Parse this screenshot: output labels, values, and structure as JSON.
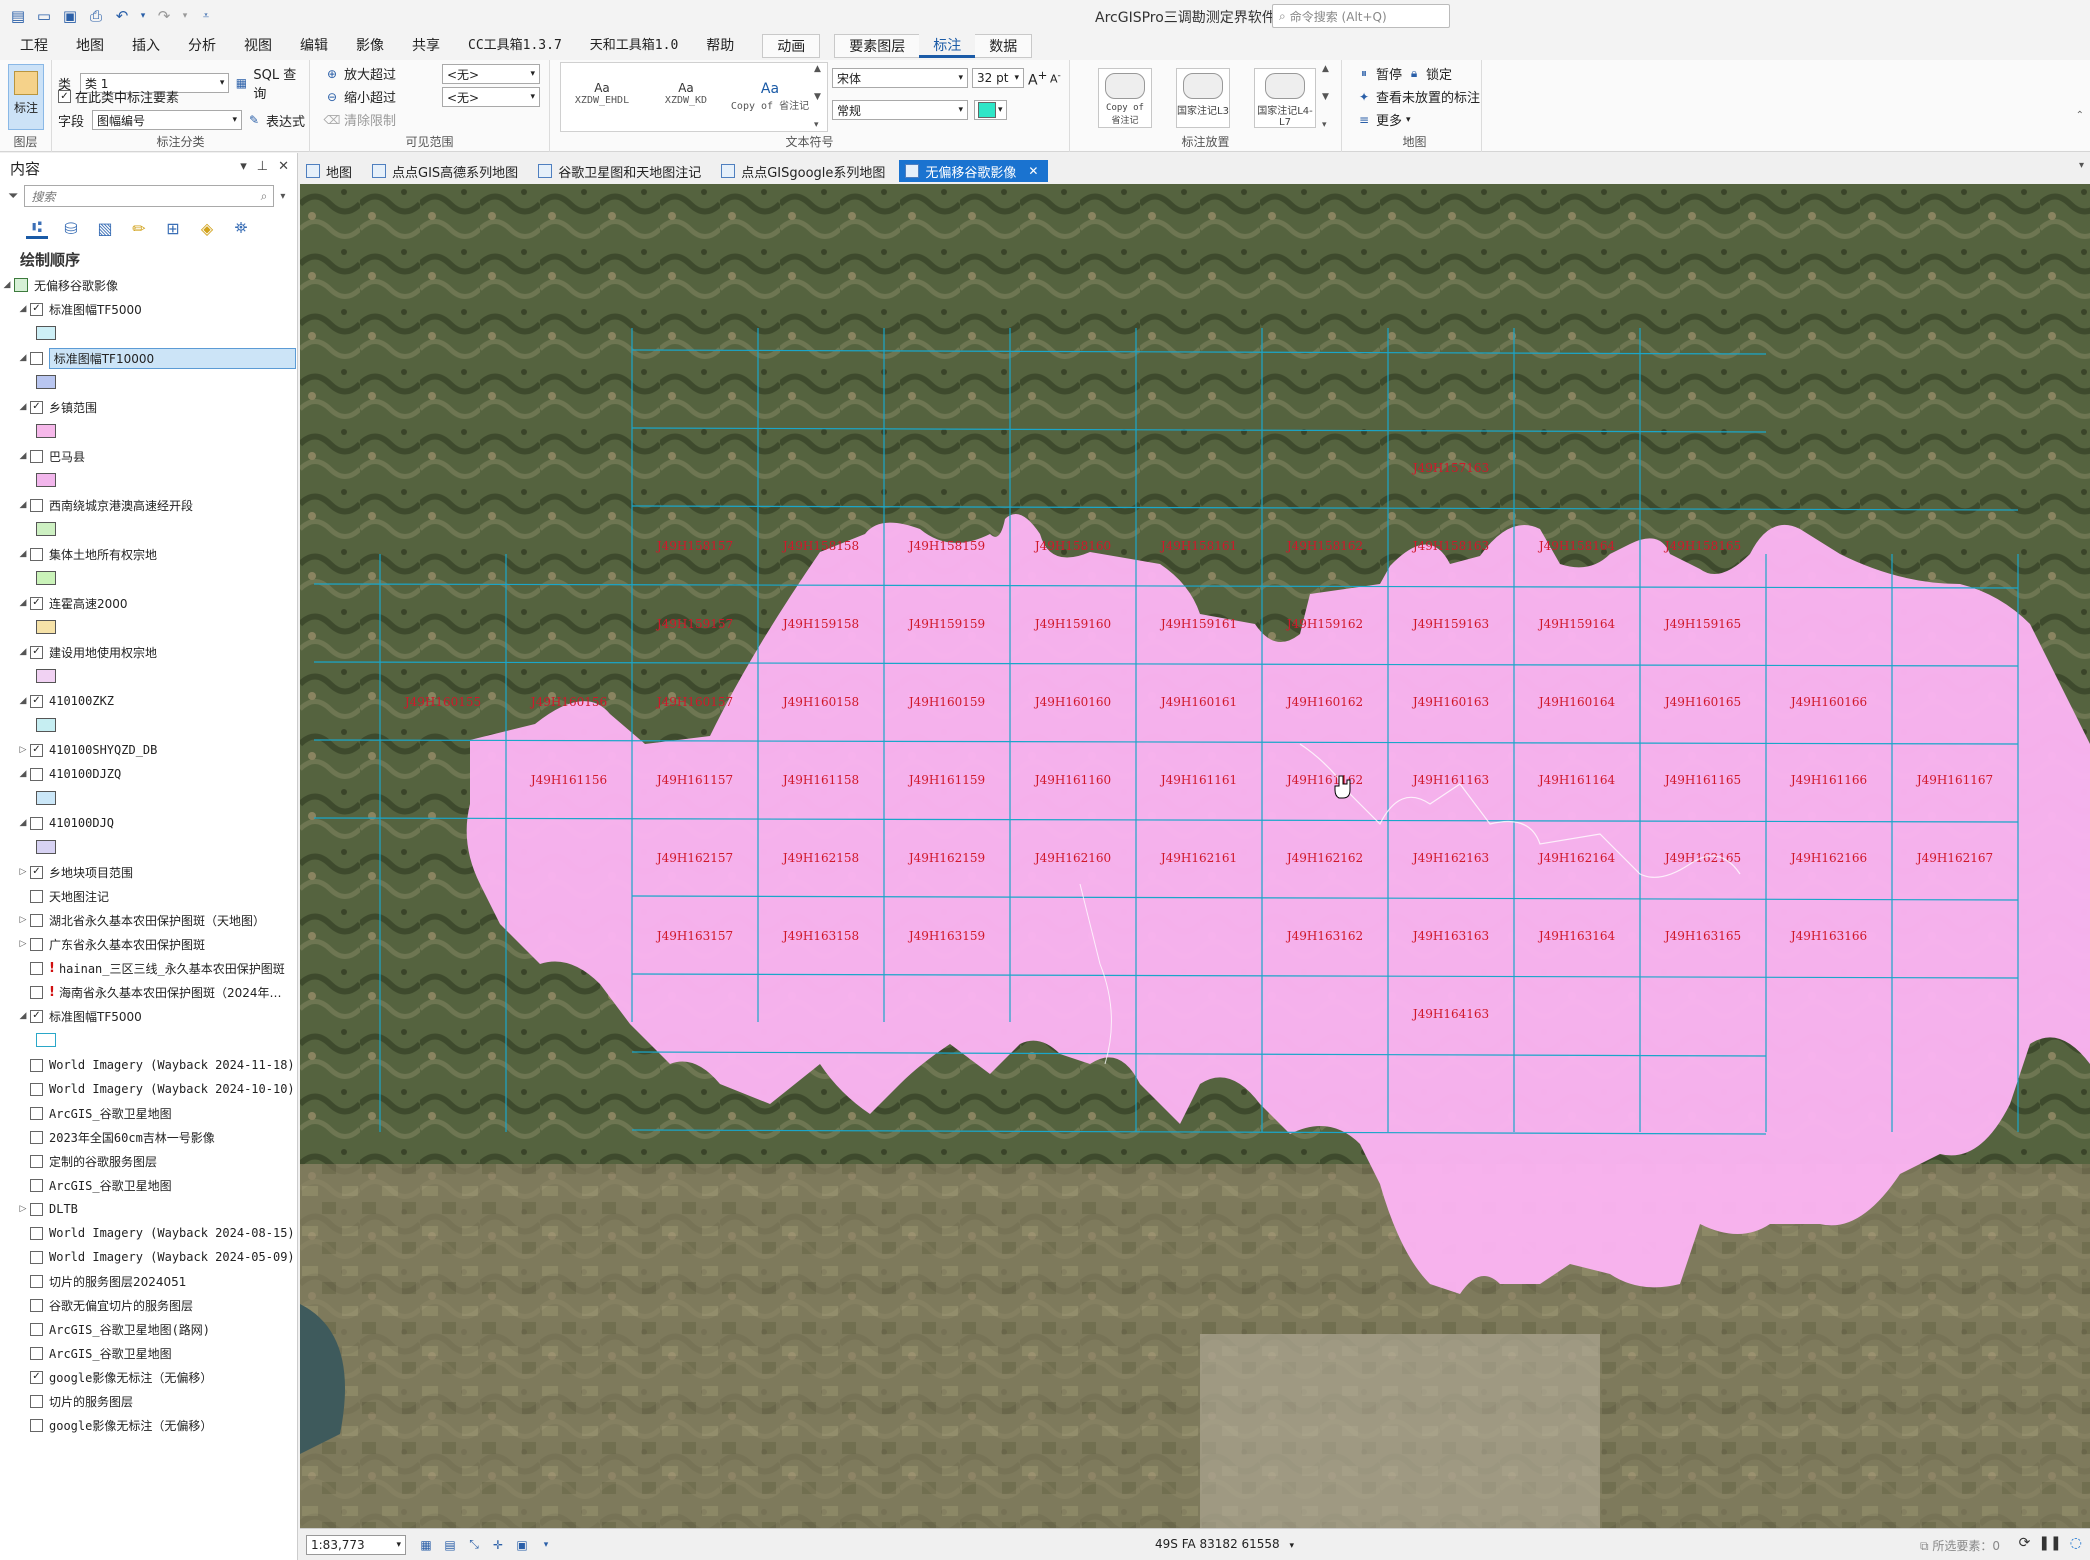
{
  "app": {
    "title": "ArcGISPro三调勘测定界软件",
    "command_search_placeholder": "命令搜索 (Alt+Q)"
  },
  "ribbon_tabs": [
    {
      "label": "工程"
    },
    {
      "label": "地图"
    },
    {
      "label": "插入"
    },
    {
      "label": "分析"
    },
    {
      "label": "视图"
    },
    {
      "label": "编辑"
    },
    {
      "label": "影像"
    },
    {
      "label": "共享"
    },
    {
      "label": "CC工具箱1.3.7"
    },
    {
      "label": "天和工具箱1.0"
    },
    {
      "label": "帮助"
    },
    {
      "label": "动画"
    },
    {
      "label": "要素图层"
    },
    {
      "label": "标注"
    },
    {
      "label": "数据"
    }
  ],
  "ribbon": {
    "layer_group": {
      "button": "标注",
      "title": "图层"
    },
    "class_group": {
      "class_label": "类",
      "class_value": "类 1",
      "sql_button": "SQL 查询",
      "label_in_class": "在此类中标注要素",
      "field_label": "字段",
      "field_value": "图幅编号",
      "expression_button": "表达式",
      "title": "标注分类"
    },
    "visibility_group": {
      "zoom_in_beyond": "放大超过",
      "zoom_out_beyond": "缩小超过",
      "clear_limits": "清除限制",
      "in_value": "<无>",
      "out_value": "<无>",
      "title": "可见范围"
    },
    "text_symbol_group": {
      "styles": [
        "XZDW_EHDL",
        "XZDW_KD",
        "Copy of 省注记"
      ],
      "style_glyph": "Aa",
      "font": "宋体",
      "font_size": "32 pt",
      "font_style": "常规",
      "color": "#2ee6c7",
      "title": "文本符号"
    },
    "placement_group": {
      "items": [
        "Copy of 省注记",
        "国家注记L3",
        "国家注记L4-L7"
      ],
      "title": "标注放置"
    },
    "map_group": {
      "pause": "暂停",
      "lock": "锁定",
      "view_unplaced": "查看未放置的标注",
      "more": "更多",
      "title": "地图"
    }
  },
  "contents": {
    "title": "内容",
    "search_placeholder": "搜索",
    "draw_order": "绘制顺序",
    "map_name": "无偏移谷歌影像",
    "layers": [
      {
        "label": "标准图幅TF5000",
        "checked": true,
        "expand": "▲",
        "symbol": "#cdeff6"
      },
      {
        "label": "标准图幅TF10000",
        "checked": false,
        "expand": "▲",
        "symbol": "#b9c6f0",
        "selected": true
      },
      {
        "label": "乡镇范围",
        "checked": true,
        "expand": "▲",
        "symbol": "#f6b8ea"
      },
      {
        "label": "巴马县",
        "checked": false,
        "expand": "▲",
        "symbol": "#f2b6ec"
      },
      {
        "label": "西南绕城京港澳高速经开段",
        "checked": false,
        "expand": "▲",
        "symbol": "#cdf0c2"
      },
      {
        "label": "集体土地所有权宗地",
        "checked": false,
        "expand": "▲",
        "symbol": "#caf3b9"
      },
      {
        "label": "连霍高速2000",
        "checked": true,
        "expand": "▲",
        "symbol": "#f6e2a8"
      },
      {
        "label": "建设用地使用权宗地",
        "checked": true,
        "expand": "▲",
        "symbol": "#f1d2f3"
      },
      {
        "label": "410100ZKZ",
        "checked": true,
        "expand": "▲",
        "symbol": "#c6eef2"
      },
      {
        "label": "410100SHYQZD_DB",
        "checked": true,
        "expand": "▶"
      },
      {
        "label": "410100DJZQ",
        "checked": false,
        "expand": "▲",
        "symbol": "#cbe7f8"
      },
      {
        "label": "410100DJQ",
        "checked": false,
        "expand": "▲",
        "symbol": "#d7d2f3"
      },
      {
        "label": "乡地块项目范围",
        "checked": true,
        "expand": "▶"
      },
      {
        "label": "天地图注记",
        "checked": false,
        "expand": ""
      },
      {
        "label": "湖北省永久基本农田保护图斑（天地图）",
        "checked": false,
        "expand": "▶"
      },
      {
        "label": "广东省永久基本农田保护图斑",
        "checked": false,
        "expand": "▶"
      },
      {
        "label": "hainan_三区三线_永久基本农田保护图斑",
        "checked": false,
        "expand": "",
        "warn": true
      },
      {
        "label": "海南省永久基本农田保护图斑（2024年…",
        "checked": false,
        "expand": "",
        "warn": true
      },
      {
        "label": "标准图幅TF5000",
        "checked": true,
        "expand": "▲",
        "symbol": "#ffffff",
        "symbol_border": "#2aa7c8"
      },
      {
        "label": "World Imagery (Wayback 2024-11-18)",
        "checked": false,
        "expand": ""
      },
      {
        "label": "World Imagery (Wayback 2024-10-10)",
        "checked": false,
        "expand": ""
      },
      {
        "label": "ArcGIS_谷歌卫星地图",
        "checked": false,
        "expand": ""
      },
      {
        "label": "2023年全国60cm吉林一号影像",
        "checked": false,
        "expand": ""
      },
      {
        "label": "定制的谷歌服务图层",
        "checked": false,
        "expand": ""
      },
      {
        "label": "ArcGIS_谷歌卫星地图",
        "checked": false,
        "expand": ""
      },
      {
        "label": "DLTB",
        "checked": false,
        "expand": "▶"
      },
      {
        "label": "World Imagery (Wayback 2024-08-15)",
        "checked": false,
        "expand": ""
      },
      {
        "label": "World Imagery (Wayback 2024-05-09)",
        "checked": false,
        "expand": ""
      },
      {
        "label": "切片的服务图层2024051",
        "checked": false,
        "expand": ""
      },
      {
        "label": "谷歌无偏宜切片的服务图层",
        "checked": false,
        "expand": ""
      },
      {
        "label": "ArcGIS_谷歌卫星地图(路网)",
        "checked": false,
        "expand": ""
      },
      {
        "label": "ArcGIS_谷歌卫星地图",
        "checked": false,
        "expand": ""
      },
      {
        "label": "google影像无标注（无偏移）",
        "checked": true,
        "expand": ""
      },
      {
        "label": "切片的服务图层",
        "checked": false,
        "expand": ""
      },
      {
        "label": "google影像无标注（无偏移）",
        "checked": false,
        "expand": ""
      }
    ]
  },
  "map_tabs": [
    {
      "label": "地图"
    },
    {
      "label": "点点GIS高德系列地图"
    },
    {
      "label": "谷歌卫星图和天地图注记"
    },
    {
      "label": "点点GISgoogle系列地图"
    },
    {
      "label": "无偏移谷歌影像",
      "active": true
    }
  ],
  "map": {
    "sheet_prefix": "J49H",
    "rows": [
      157,
      158,
      159,
      160,
      161,
      162,
      163,
      164,
      165
    ],
    "grid_color": "#1aa6c9",
    "label_color": "#d0182b",
    "fill_color": "#fbb4f2",
    "labels": [
      {
        "text": "J49H158157",
        "col": 0,
        "row": 1
      },
      {
        "text": "J49H158158",
        "col": 1,
        "row": 1
      },
      {
        "text": "J49H158159",
        "col": 2,
        "row": 1
      },
      {
        "text": "J49H158160",
        "col": 3,
        "row": 1
      },
      {
        "text": "J49H158161",
        "col": 4,
        "row": 1
      },
      {
        "text": "J49H158162",
        "col": 5,
        "row": 1
      },
      {
        "text": "J49H158163",
        "col": 6,
        "row": 1
      },
      {
        "text": "J49H158164",
        "col": 7,
        "row": 1
      },
      {
        "text": "J49H158165",
        "col": 8,
        "row": 1
      },
      {
        "text": "J49H157163",
        "col": 6,
        "row": 0
      },
      {
        "text": "J49H159157",
        "col": 0,
        "row": 2
      },
      {
        "text": "J49H159158",
        "col": 1,
        "row": 2
      },
      {
        "text": "J49H159159",
        "col": 2,
        "row": 2
      },
      {
        "text": "J49H159160",
        "col": 3,
        "row": 2
      },
      {
        "text": "J49H159161",
        "col": 4,
        "row": 2
      },
      {
        "text": "J49H159162",
        "col": 5,
        "row": 2
      },
      {
        "text": "J49H159163",
        "col": 6,
        "row": 2
      },
      {
        "text": "J49H159164",
        "col": 7,
        "row": 2
      },
      {
        "text": "J49H159165",
        "col": 8,
        "row": 2
      },
      {
        "text": "J49H160155",
        "col": -2,
        "row": 3
      },
      {
        "text": "J49H160156",
        "col": -1,
        "row": 3
      },
      {
        "text": "J49H160157",
        "col": 0,
        "row": 3
      },
      {
        "text": "J49H160158",
        "col": 1,
        "row": 3
      },
      {
        "text": "J49H160159",
        "col": 2,
        "row": 3
      },
      {
        "text": "J49H160160",
        "col": 3,
        "row": 3
      },
      {
        "text": "J49H160161",
        "col": 4,
        "row": 3
      },
      {
        "text": "J49H160162",
        "col": 5,
        "row": 3
      },
      {
        "text": "J49H160163",
        "col": 6,
        "row": 3
      },
      {
        "text": "J49H160164",
        "col": 7,
        "row": 3
      },
      {
        "text": "J49H160165",
        "col": 8,
        "row": 3
      },
      {
        "text": "J49H160166",
        "col": 9,
        "row": 3
      },
      {
        "text": "J49H161156",
        "col": -1,
        "row": 4
      },
      {
        "text": "J49H161157",
        "col": 0,
        "row": 4
      },
      {
        "text": "J49H161158",
        "col": 1,
        "row": 4
      },
      {
        "text": "J49H161159",
        "col": 2,
        "row": 4
      },
      {
        "text": "J49H161160",
        "col": 3,
        "row": 4
      },
      {
        "text": "J49H161161",
        "col": 4,
        "row": 4
      },
      {
        "text": "J49H161162",
        "col": 5,
        "row": 4
      },
      {
        "text": "J49H161163",
        "col": 6,
        "row": 4
      },
      {
        "text": "J49H161164",
        "col": 7,
        "row": 4
      },
      {
        "text": "J49H161165",
        "col": 8,
        "row": 4
      },
      {
        "text": "J49H161166",
        "col": 9,
        "row": 4
      },
      {
        "text": "J49H161167",
        "col": 10,
        "row": 4
      },
      {
        "text": "J49H162157",
        "col": 0,
        "row": 5
      },
      {
        "text": "J49H162158",
        "col": 1,
        "row": 5
      },
      {
        "text": "J49H162159",
        "col": 2,
        "row": 5
      },
      {
        "text": "J49H162160",
        "col": 3,
        "row": 5
      },
      {
        "text": "J49H162161",
        "col": 4,
        "row": 5
      },
      {
        "text": "J49H162162",
        "col": 5,
        "row": 5
      },
      {
        "text": "J49H162163",
        "col": 6,
        "row": 5
      },
      {
        "text": "J49H162164",
        "col": 7,
        "row": 5
      },
      {
        "text": "J49H162165",
        "col": 8,
        "row": 5
      },
      {
        "text": "J49H162166",
        "col": 9,
        "row": 5
      },
      {
        "text": "J49H162167",
        "col": 10,
        "row": 5
      },
      {
        "text": "J49H163157",
        "col": 0,
        "row": 6
      },
      {
        "text": "J49H163158",
        "col": 1,
        "row": 6
      },
      {
        "text": "J49H163159",
        "col": 2,
        "row": 6
      },
      {
        "text": "J49H163162",
        "col": 5,
        "row": 6
      },
      {
        "text": "J49H163163",
        "col": 6,
        "row": 6
      },
      {
        "text": "J49H163164",
        "col": 7,
        "row": 6
      },
      {
        "text": "J49H163165",
        "col": 8,
        "row": 6
      },
      {
        "text": "J49H163166",
        "col": 9,
        "row": 6
      },
      {
        "text": "J49H164163",
        "col": 6,
        "row": 7
      }
    ]
  },
  "status": {
    "scale": "1:83,773",
    "coords": "49S FA 83182 61558",
    "selected_features": "所选要素：0"
  }
}
